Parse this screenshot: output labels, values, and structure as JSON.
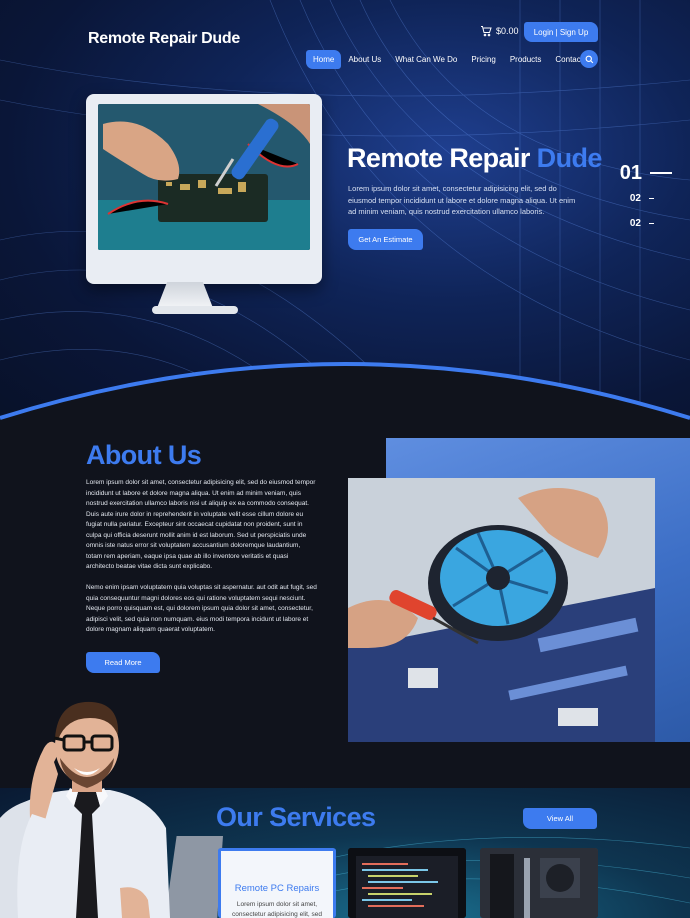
{
  "header": {
    "logo": "Remote Repair Dude",
    "cart_total": "$0.00",
    "login_label": "Login | Sign Up",
    "nav": [
      "Home",
      "About Us",
      "What Can We Do",
      "Pricing",
      "Products",
      "Contact"
    ],
    "active_nav": "Home"
  },
  "hero": {
    "title_main": "Remote Repair ",
    "title_accent": "Dude",
    "description": "Lorem ipsum dolor sit amet, consectetur adipisicing elit, sed do eiusmod tempor incididunt ut labore et dolore magna aliqua. Ut enim ad minim veniam, quis nostrud exercitation ullamco laboris.",
    "cta_label": "Get An Estimate",
    "slides": [
      "01",
      "02",
      "02"
    ]
  },
  "about": {
    "title": "About Us",
    "paragraph1": "Lorem ipsum dolor sit amet, consectetur adipisicing elit, sed do eiusmod tempor incididunt ut labore et dolore magna aliqua. Ut enim ad minim veniam, quis nostrud exercitation ullamco laboris nisi ut aliquip ex ea commodo consequat. Duis aute irure dolor in reprehenderit in voluptate velit esse cillum dolore eu fugiat nulla pariatur. Excepteur sint occaecat cupidatat non proident, sunt in culpa qui officia deserunt mollit anim id est laborum. Sed ut perspiciatis unde omnis iste natus error sit voluptatem accusantium doloremque laudantium, totam rem aperiam, eaque ipsa quae ab illo inventore veritatis et quasi architecto beatae vitae dicta sunt explicabo.",
    "paragraph2": "Nemo enim ipsam voluptatem quia voluptas sit aspernatur. aut odit aut fugit, sed quia consequuntur magni dolores eos qui ratione voluptatem sequi nesciunt. Neque porro quisquam est, qui dolorem ipsum quia dolor sit amet, consectetur, adipisci velit, sed quia non numquam. eius modi tempora incidunt ut labore et dolore magnam aliquam quaerat voluptatem.",
    "button_label": "Read More"
  },
  "services": {
    "title": "Our Services",
    "view_all_label": "View All",
    "card_title": "Remote PC Repairs",
    "card_text": "Lorem ipsum dolor sit amet, consectetur adipisicing elit, sed"
  },
  "colors": {
    "accent": "#3d7bef",
    "hero_bg": "#0f2458",
    "about_bg": "#10131c"
  },
  "icons": [
    "cart-icon",
    "search-icon"
  ]
}
